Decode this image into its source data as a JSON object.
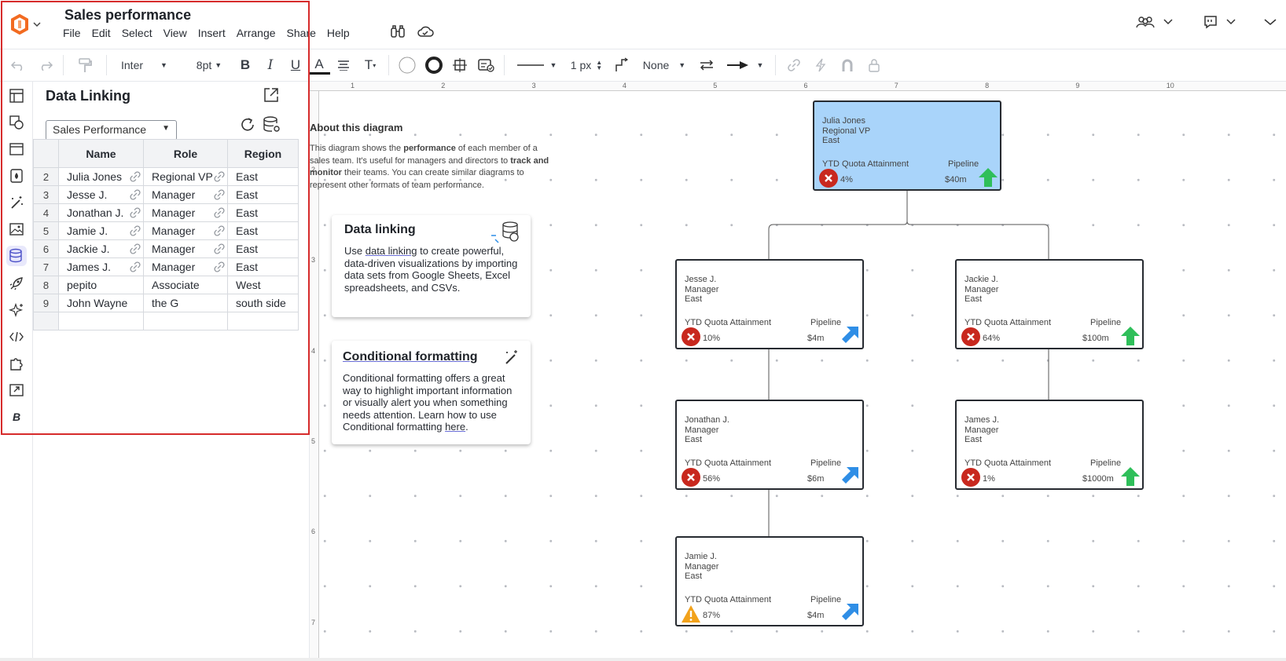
{
  "doc": {
    "title": "Sales performance"
  },
  "menu": [
    "File",
    "Edit",
    "Select",
    "View",
    "Insert",
    "Arrange",
    "Share",
    "Help"
  ],
  "toolbar": {
    "font": "Inter",
    "font_size": "8pt",
    "line_width": "1 px",
    "arrow_start": "None"
  },
  "panel": {
    "title": "Data Linking",
    "sheet": "Sales Performance",
    "columns": [
      "Name",
      "Role",
      "Region"
    ],
    "rows": [
      {
        "n": "2",
        "name": "Julia Jones",
        "role": "Regional VP",
        "region": "East"
      },
      {
        "n": "3",
        "name": "Jesse J.",
        "role": "Manager",
        "region": "East"
      },
      {
        "n": "4",
        "name": "Jonathan J.",
        "role": "Manager",
        "region": "East"
      },
      {
        "n": "5",
        "name": "Jamie J.",
        "role": "Manager",
        "region": "East"
      },
      {
        "n": "6",
        "name": "Jackie J.",
        "role": "Manager",
        "region": "East"
      },
      {
        "n": "7",
        "name": "James J.",
        "role": "Manager",
        "region": "East"
      },
      {
        "n": "8",
        "name": "pepito",
        "role": "Associate",
        "region": "West"
      },
      {
        "n": "9",
        "name": "John Wayne",
        "role": "the G",
        "region": "south side"
      },
      {
        "n": "",
        "name": "",
        "role": "",
        "region": ""
      }
    ]
  },
  "canvas": {
    "about_title": "About this diagram",
    "about_text_1": "This diagram shows the ",
    "about_bold_1": "performance",
    "about_text_2": " of each member of a sales team. It's useful for managers and directors to ",
    "about_bold_2": "track and monitor",
    "about_text_3": " their teams. You can create similar diagrams to represent other formats of team performance.",
    "card_data_linking": {
      "title": "Data linking",
      "pre": "Use ",
      "link": "data linking",
      "post": " to create powerful, data-driven visualizations by importing data sets from Google Sheets, Excel spreadsheets, and CSVs."
    },
    "card_cond": {
      "title": "Conditional formatting",
      "pre": "Conditional formatting offers a great way to highlight important information or visually alert you when something needs attention. Learn how to use Conditional formatting ",
      "link": "here",
      "post": "."
    },
    "quota_label": "YTD Quota Attainment",
    "pipeline_label": "Pipeline",
    "ruler_top": [
      "1",
      "2",
      "3",
      "4",
      "5",
      "6",
      "7",
      "8",
      "9",
      "10"
    ],
    "ruler_left": [
      "2",
      "3",
      "4",
      "5",
      "6",
      "7"
    ],
    "nodes": [
      {
        "name": "Julia Jones",
        "role": "Regional VP",
        "region": "East",
        "quota": "4%",
        "pipeline": "$40m",
        "status": "fail",
        "trend": "up",
        "highlight": true
      },
      {
        "name": "Jesse J.",
        "role": "Manager",
        "region": "East",
        "quota": "10%",
        "pipeline": "$4m",
        "status": "fail",
        "trend": "up-right"
      },
      {
        "name": "Jackie J.",
        "role": "Manager",
        "region": "East",
        "quota": "64%",
        "pipeline": "$100m",
        "status": "fail",
        "trend": "up"
      },
      {
        "name": "Jonathan J.",
        "role": "Manager",
        "region": "East",
        "quota": "56%",
        "pipeline": "$6m",
        "status": "fail",
        "trend": "up-right"
      },
      {
        "name": "James J.",
        "role": "Manager",
        "region": "East",
        "quota": "1%",
        "pipeline": "$1000m",
        "status": "fail",
        "trend": "up"
      },
      {
        "name": "Jamie J.",
        "role": "Manager",
        "region": "East",
        "quota": "87%",
        "pipeline": "$4m",
        "status": "warn",
        "trend": "up-right"
      }
    ]
  },
  "colors": {
    "accent": "#6b6fd6",
    "selection": "#d62b2b",
    "fail": "#c8281e",
    "warn": "#f2a21b",
    "up": "#2fbf5a",
    "up_right": "#2f8ee6",
    "node_hl": "#a9d4fa"
  }
}
